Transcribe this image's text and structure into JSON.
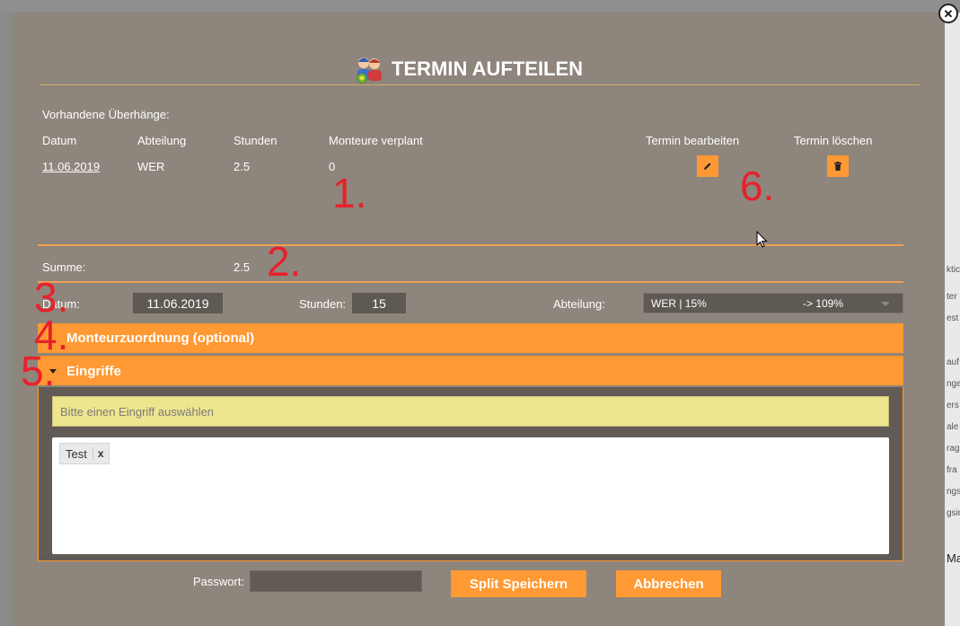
{
  "background": {
    "right_edge_fragments": [
      "ktic",
      "ter",
      "est",
      "auf",
      "nge",
      "ers",
      "ale",
      "rag",
      "fra",
      "ngs",
      "gsir",
      "Mar"
    ]
  },
  "modal": {
    "title": "TERMIN AUFTEILEN",
    "title_icon": "users-split-icon",
    "close_icon": "close-icon"
  },
  "overhangs": {
    "section_label": "Vorhandene Überhänge:",
    "columns": {
      "date": "Datum",
      "department": "Abteilung",
      "hours": "Stunden",
      "fitters": "Monteure verplant",
      "edit": "Termin bearbeiten",
      "delete": "Termin löschen"
    },
    "rows": [
      {
        "date": "11.06.2019",
        "department": "WER",
        "hours": "2.5",
        "fitters": "0"
      }
    ],
    "edit_icon": "pencil-icon",
    "delete_icon": "trash-icon"
  },
  "sum": {
    "label": "Summe:",
    "value": "2.5"
  },
  "form": {
    "date_label": "Datum:",
    "date_value": "11.06.2019",
    "hours_label": "Stunden:",
    "hours_value": "15",
    "department_label": "Abteilung:",
    "department_value": "WER | 15%",
    "department_extra": "-> 109%"
  },
  "accordions": {
    "fitters": "Monteurzuordnung (optional)",
    "interventions": "Eingriffe"
  },
  "interventions": {
    "placeholder": "Bitte einen Eingriff auswählen",
    "tags": [
      {
        "label": "Test",
        "remove": "x"
      }
    ]
  },
  "footer": {
    "password_label": "Passwort:",
    "save_label": "Split Speichern",
    "cancel_label": "Abbrechen"
  },
  "annotations": {
    "n1": "1.",
    "n2": "2.",
    "n3": "3.",
    "n4": "4.",
    "n5": "5.",
    "n6": "6."
  },
  "colors": {
    "accent": "#ff9933",
    "modal_bg": "#8e857c",
    "annotation_red": "#e8202a",
    "search_bg": "#eee58f"
  }
}
